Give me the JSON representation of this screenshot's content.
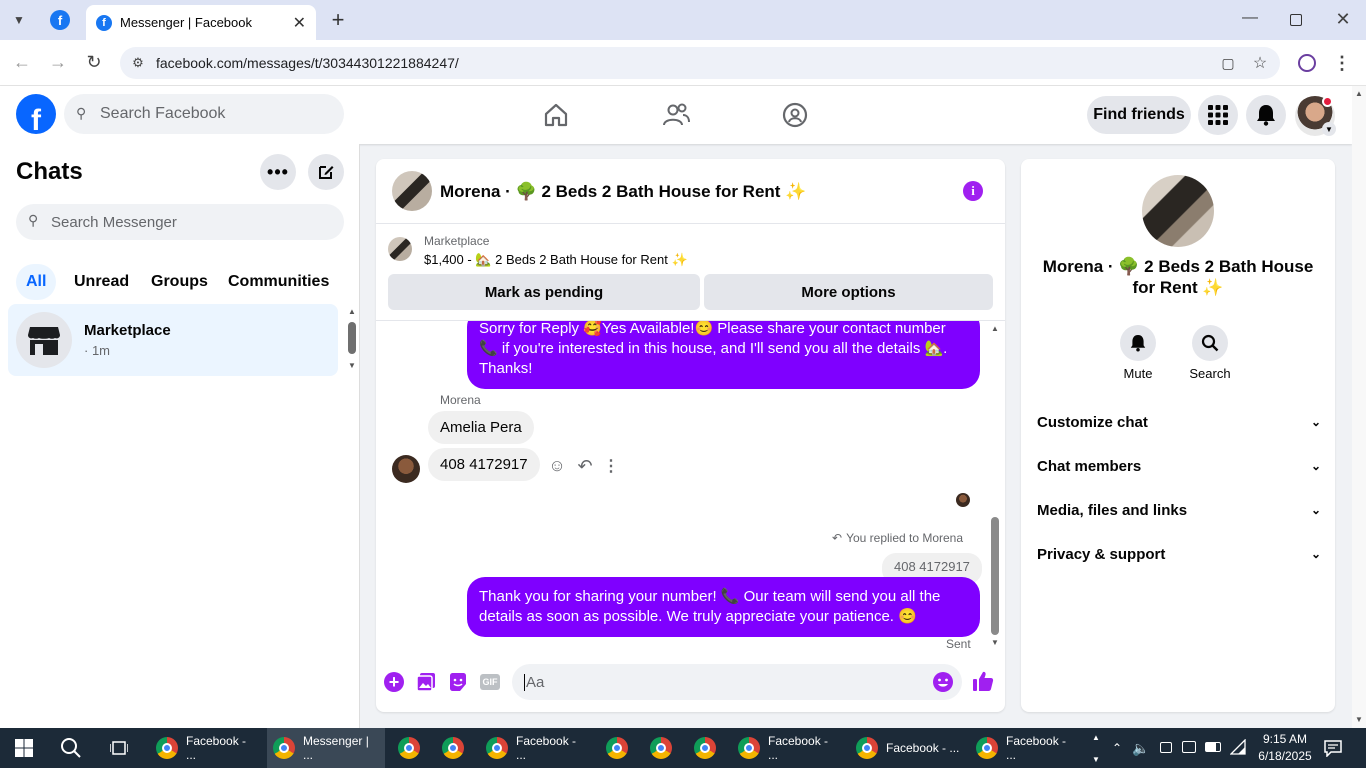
{
  "browser": {
    "tab_title": "Messenger | Facebook",
    "url": "facebook.com/messages/t/30344301221884247/"
  },
  "header": {
    "search_placeholder": "Search Facebook",
    "find_friends": "Find friends"
  },
  "sidebar": {
    "title": "Chats",
    "search_placeholder": "Search Messenger",
    "filters": [
      "All",
      "Unread",
      "Groups",
      "Communities"
    ],
    "chats": [
      {
        "name": "Marketplace",
        "meta": "· 1m"
      }
    ]
  },
  "chat": {
    "title": "Morena · 🌳 2 Beds 2 Bath House for Rent ✨",
    "listing": {
      "source": "Marketplace",
      "summary": "$1,400 - 🏡 2 Beds 2 Bath House for Rent ✨"
    },
    "mark_pending": "Mark as pending",
    "more_options": "More options",
    "messages": {
      "my_first": "Sorry for Reply 🥰Yes Available!😊 Please share your contact number 📞 if you're interested in this house, and I'll send you all the details 🏡. Thanks!",
      "sender_name": "Morena",
      "their_1": "Amelia Pera",
      "their_2": "408 4172917",
      "reply_note": "You replied to Morena",
      "quoted": "408 4172917",
      "my_last": "Thank you for sharing your number! 📞 Our team will send you all the details as soon as possible. We truly appreciate your patience. 😊",
      "status": "Sent"
    },
    "composer_placeholder": "Aa"
  },
  "details": {
    "name": "Morena · 🌳 2 Beds 2 Bath House for Rent ✨",
    "mute": "Mute",
    "search": "Search",
    "sections": [
      "Customize chat",
      "Chat members",
      "Media, files and links",
      "Privacy & support"
    ]
  },
  "taskbar": {
    "items": [
      "Facebook - ...",
      "Messenger | ...",
      "Facebook - ...",
      "Facebook - ...",
      "Facebook - ...",
      "Facebook - ..."
    ],
    "time": "9:15 AM",
    "date": "6/18/2025"
  },
  "colors": {
    "fb_blue": "#0866ff",
    "my_bubble": "#7f00ff",
    "accent_purple": "#a020f0"
  }
}
